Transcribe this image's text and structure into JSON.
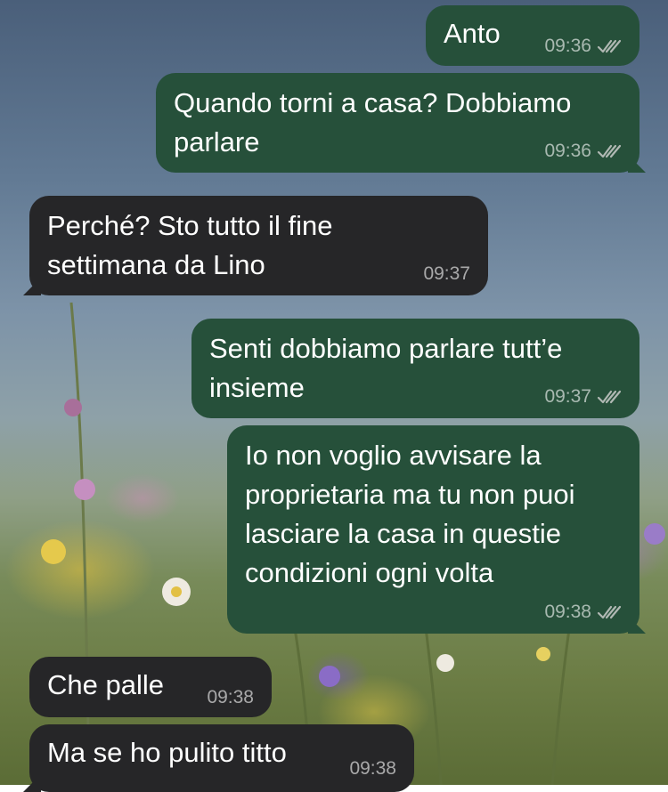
{
  "wallpaper": {
    "description": "meadow-flowers-sky"
  },
  "colors": {
    "outgoing_bubble": "#26503a",
    "incoming_bubble": "#262628",
    "text": "#ffffff",
    "meta_text": "#b0b8b3"
  },
  "messages": [
    {
      "direction": "out",
      "text": "Anto",
      "time": "09:36",
      "status": "read"
    },
    {
      "direction": "out",
      "text": "Quando torni a casa? Dobbiamo\nparlare",
      "time": "09:36",
      "status": "read"
    },
    {
      "direction": "in",
      "text": "Perché? Sto tutto il fine\nsettimana da Lino",
      "time": "09:37"
    },
    {
      "direction": "out",
      "text": "Senti dobbiamo parlare tutt’e\ninsieme",
      "time": "09:37",
      "status": "read"
    },
    {
      "direction": "out",
      "text": "Io non voglio avvisare la\nproprietaria ma tu non puoi\nlasciare la casa in questie\ncondizioni ogni volta",
      "time": "09:38",
      "status": "read"
    },
    {
      "direction": "in",
      "text": "Che palle",
      "time": "09:38"
    },
    {
      "direction": "in",
      "text": "Ma se ho pulito titto",
      "time": "09:38"
    }
  ]
}
